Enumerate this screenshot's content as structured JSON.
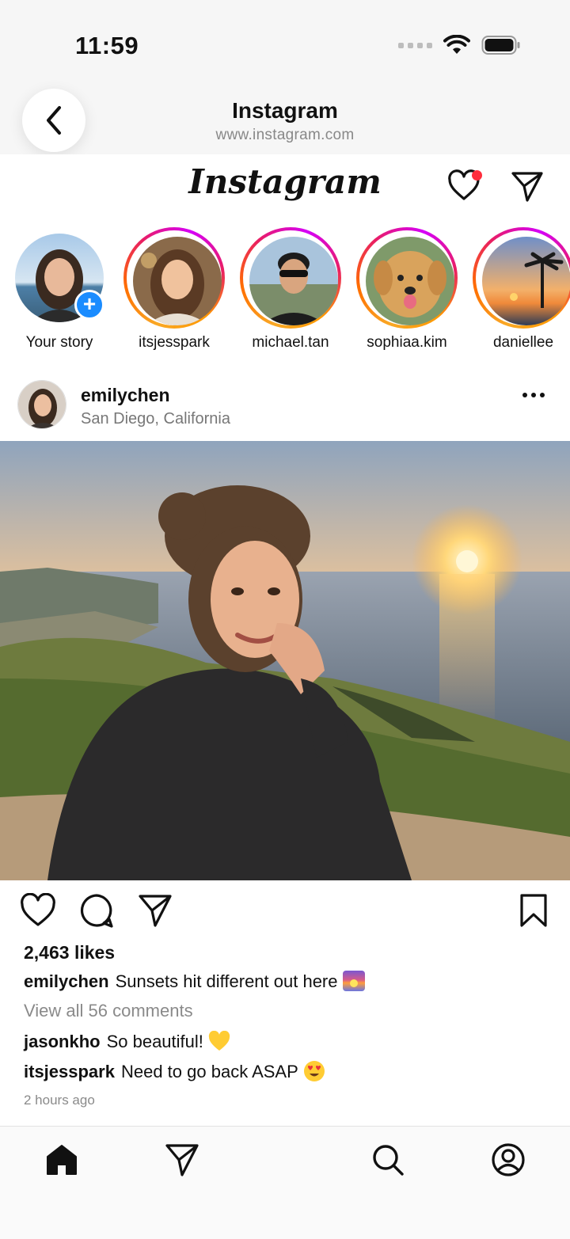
{
  "status_bar": {
    "time": "11:59"
  },
  "browser": {
    "title": "Instagram",
    "url": "www.instagram.com"
  },
  "ig": {
    "logo_text": "Instagram"
  },
  "stories": [
    {
      "label": "Your story",
      "is_own": true,
      "add_badge": "+"
    },
    {
      "label": "itsjesspark"
    },
    {
      "label": "michael.tan"
    },
    {
      "label": "sophiaa.kim"
    },
    {
      "label": "daniellee"
    }
  ],
  "post": {
    "username": "emilychen",
    "location": "San Diego, California",
    "likes": "2,463 likes",
    "caption_user": "emilychen",
    "caption_text": "Sunsets hit different out here",
    "view_comments": "View all 56 comments",
    "comments": [
      {
        "user": "jasonkho",
        "text": "So beautiful!"
      },
      {
        "user": "itsjesspark",
        "text": "Need to go back ASAP"
      }
    ],
    "time_ago": "2 hours ago"
  },
  "colors": {
    "story_ring_start": "#f9a825",
    "story_ring_end": "#d500f9",
    "notification_dot": "#ff2d3c",
    "add_badge": "#1a8cff"
  },
  "icons": [
    "back-chevron-icon",
    "heart-icon",
    "direct-message-icon",
    "more-icon",
    "comment-icon",
    "share-icon",
    "bookmark-icon",
    "home-icon",
    "search-icon",
    "profile-icon"
  ]
}
